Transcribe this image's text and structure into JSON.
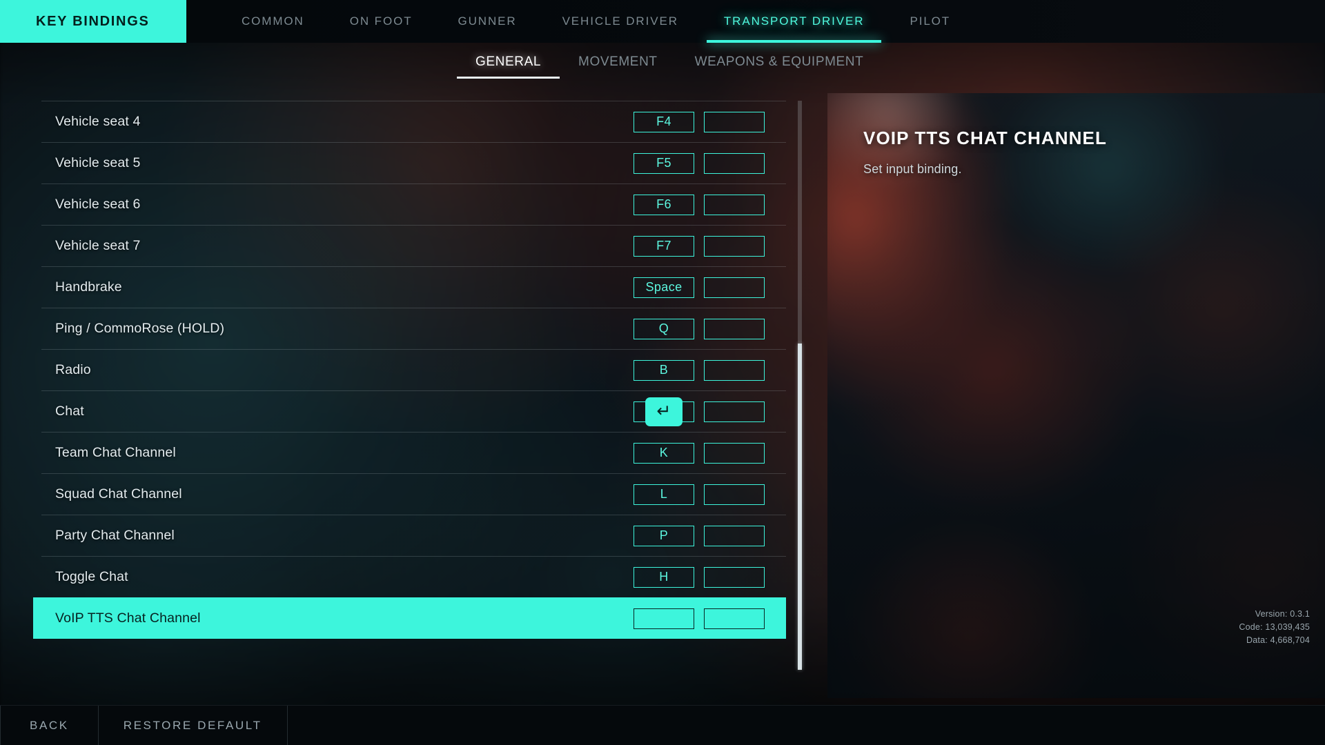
{
  "app": {
    "brand_label": "KEY BINDINGS"
  },
  "nav": {
    "tabs": [
      {
        "label": "COMMON",
        "active": false
      },
      {
        "label": "ON FOOT",
        "active": false
      },
      {
        "label": "GUNNER",
        "active": false
      },
      {
        "label": "VEHICLE DRIVER",
        "active": false
      },
      {
        "label": "TRANSPORT DRIVER",
        "active": true
      },
      {
        "label": "PILOT",
        "active": false
      }
    ]
  },
  "subtabs": {
    "tabs": [
      {
        "label": "GENERAL",
        "active": true
      },
      {
        "label": "MOVEMENT",
        "active": false
      },
      {
        "label": "WEAPONS & EQUIPMENT",
        "active": false
      }
    ]
  },
  "bindings": {
    "rows": [
      {
        "action": "Vehicle seat 4",
        "primary": "F4",
        "secondary": "",
        "selected": false,
        "primary_is_keycap": false
      },
      {
        "action": "Vehicle seat 5",
        "primary": "F5",
        "secondary": "",
        "selected": false,
        "primary_is_keycap": false
      },
      {
        "action": "Vehicle seat 6",
        "primary": "F6",
        "secondary": "",
        "selected": false,
        "primary_is_keycap": false
      },
      {
        "action": "Vehicle seat 7",
        "primary": "F7",
        "secondary": "",
        "selected": false,
        "primary_is_keycap": false
      },
      {
        "action": "Handbrake",
        "primary": "Space",
        "secondary": "",
        "selected": false,
        "primary_is_keycap": false
      },
      {
        "action": "Ping / CommoRose (HOLD)",
        "primary": "Q",
        "secondary": "",
        "selected": false,
        "primary_is_keycap": false
      },
      {
        "action": "Radio",
        "primary": "B",
        "secondary": "",
        "selected": false,
        "primary_is_keycap": false
      },
      {
        "action": "Chat",
        "primary": "↵",
        "secondary": "",
        "selected": false,
        "primary_is_keycap": true
      },
      {
        "action": "Team Chat Channel",
        "primary": "K",
        "secondary": "",
        "selected": false,
        "primary_is_keycap": false
      },
      {
        "action": "Squad Chat Channel",
        "primary": "L",
        "secondary": "",
        "selected": false,
        "primary_is_keycap": false
      },
      {
        "action": "Party Chat Channel",
        "primary": "P",
        "secondary": "",
        "selected": false,
        "primary_is_keycap": false
      },
      {
        "action": "Toggle Chat",
        "primary": "H",
        "secondary": "",
        "selected": false,
        "primary_is_keycap": false
      },
      {
        "action": "VoIP TTS Chat Channel",
        "primary": "",
        "secondary": "",
        "selected": true,
        "primary_is_keycap": false
      }
    ]
  },
  "info": {
    "title": "VOIP TTS CHAT CHANNEL",
    "description": "Set input binding."
  },
  "build": {
    "version": "Version: 0.3.1",
    "code": "Code: 13,039,435",
    "data": "Data: 4,668,704"
  },
  "footer": {
    "back_label": "BACK",
    "restore_label": "RESTORE DEFAULT"
  },
  "colors": {
    "accent": "#3df5dc",
    "accent_text": "#5cf7e0",
    "selected_text": "#062220",
    "panel_bg": "#05090c"
  }
}
